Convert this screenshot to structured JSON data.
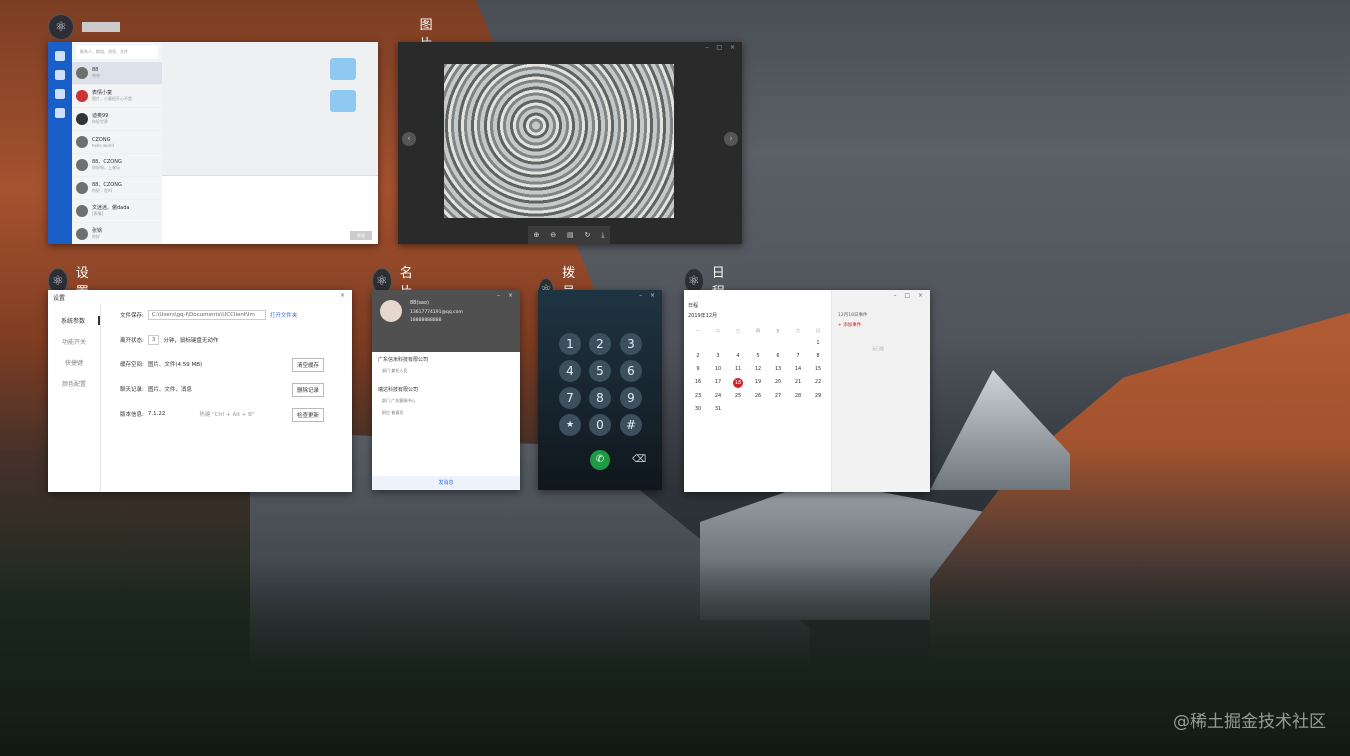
{
  "windows": {
    "chat": {
      "title": "",
      "search_placeholder": "联系人、群组、消息、文件",
      "contacts": [
        {
          "name": "88",
          "msg": "哈哈"
        },
        {
          "name": "表情小童",
          "msg": "图片，小童很开心不是"
        },
        {
          "name": "迪奥99",
          "msg": "你好世界"
        },
        {
          "name": "CZONG",
          "msg": "hello world"
        },
        {
          "name": "88、CZONG",
          "msg": "你好呀，上来玩"
        },
        {
          "name": "88、CZONG",
          "msg": "你好，在吗"
        },
        {
          "name": "文迷迷、傲dada",
          "msg": "[表情]"
        },
        {
          "name": "张锅",
          "msg": "你好"
        }
      ],
      "send_label": "发送"
    },
    "viewer": {
      "title": "图片查看器"
    },
    "settings": {
      "title": "设置",
      "window_title": "设置",
      "nav": [
        "系统参数",
        "功能开关",
        "快捷键",
        "颜色配置"
      ],
      "rows": {
        "file_store_label": "文件保存:",
        "file_store_value": "C:\\Users\\gq-l\\Documents\\UCClient\\Im",
        "open_folder": "打开文件夹",
        "away_label": "离开状态:",
        "away_value": "3",
        "away_suffix": "分钟，鼠标键盘无动作",
        "cache_label": "缓存空间:",
        "cache_value": "图片、文件(4.59 MB)",
        "cache_btn": "清空缓存",
        "history_label": "聊天记录:",
        "history_value": "图片、文件、消息",
        "history_btn": "删除记录",
        "version_label": "版本信息:",
        "version_value": "7.1.22",
        "shortcut_hint": "热键 \"Ctrl + Alt + B\"",
        "update_btn": "检查更新"
      }
    },
    "card": {
      "title": "名片",
      "name": "88(sao)",
      "email": "13617774191@qq.com",
      "phone": "18888888888",
      "company1": "广东信米科技有限公司",
      "dept1_label": "部门",
      "dept1": "兼任人员",
      "company2": "瑞达科技有限公司",
      "dept2_label": "部门",
      "dept2": "广东客服中心",
      "role_label": "职位",
      "role": "普通员",
      "foot": "发消息"
    },
    "dialer": {
      "title": "拨号盘",
      "keys": [
        "1",
        "2",
        "3",
        "4",
        "5",
        "6",
        "7",
        "8",
        "9",
        "★",
        "0",
        "#"
      ]
    },
    "calendar": {
      "title": "日程",
      "app_label": "日程",
      "month_label": "2019年12月",
      "weekdays": [
        "一",
        "二",
        "三",
        "四",
        "五",
        "六",
        "日"
      ],
      "days": [
        "1",
        "2",
        "3",
        "4",
        "5",
        "6",
        "7",
        "8",
        "9",
        "10",
        "11",
        "12",
        "13",
        "14",
        "15",
        "16",
        "17",
        "18",
        "19",
        "20",
        "21",
        "22",
        "23",
        "24",
        "25",
        "26",
        "27",
        "28",
        "29",
        "30",
        "31"
      ],
      "today": "18",
      "side_title": "12月18日事件",
      "add_event": "+ 添加事件",
      "empty": "无日程"
    }
  },
  "watermark": "@稀土掘金技术社区"
}
